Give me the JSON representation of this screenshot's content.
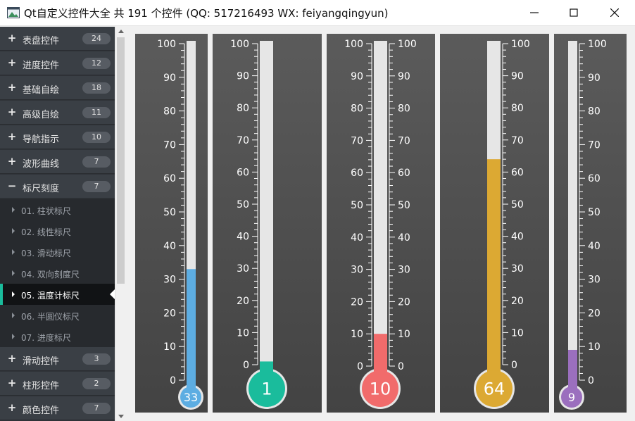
{
  "window": {
    "title": "Qt自定义控件大全 共 191 个控件 (QQ: 517216493 WX: feiyangqingyun)",
    "controls": [
      "minimize-icon",
      "maximize-icon",
      "close-icon"
    ]
  },
  "sidebar": {
    "groups": [
      {
        "sign": "+",
        "label": "表盘控件",
        "count": "24"
      },
      {
        "sign": "+",
        "label": "进度控件",
        "count": "12"
      },
      {
        "sign": "+",
        "label": "基础自绘",
        "count": "18"
      },
      {
        "sign": "+",
        "label": "高级自绘",
        "count": "11"
      },
      {
        "sign": "+",
        "label": "导航指示",
        "count": "10"
      },
      {
        "sign": "+",
        "label": "波形曲线",
        "count": "7"
      },
      {
        "sign": "−",
        "label": "标尺刻度",
        "count": "7"
      },
      {
        "sign": "+",
        "label": "滑动控件",
        "count": "3"
      },
      {
        "sign": "+",
        "label": "柱形控件",
        "count": "2"
      },
      {
        "sign": "+",
        "label": "颜色控件",
        "count": "7"
      }
    ],
    "children": [
      {
        "label": "01. 柱状标尺"
      },
      {
        "label": "02. 线性标尺"
      },
      {
        "label": "03. 滑动标尺"
      },
      {
        "label": "04. 双向刻度尺"
      },
      {
        "label": "05. 温度计标尺"
      },
      {
        "label": "06. 半圆仪标尺"
      },
      {
        "label": "07. 进度标尺"
      }
    ],
    "selected_child": "05. 温度计标尺"
  },
  "thermometers": [
    {
      "value": 33,
      "value_label": "33",
      "min": 0,
      "max": 100,
      "color": "#5dade2",
      "scale": "left",
      "tick_labels": [
        "100",
        "90",
        "80",
        "70",
        "60",
        "50",
        "40",
        "30",
        "20",
        "10",
        "0"
      ]
    },
    {
      "value": 1,
      "value_label": "1",
      "min": 0,
      "max": 100,
      "color": "#1abc9c",
      "scale": "left",
      "tick_labels": [
        "100",
        "90",
        "80",
        "70",
        "60",
        "50",
        "40",
        "30",
        "20",
        "10",
        "0"
      ]
    },
    {
      "value": 10,
      "value_label": "10",
      "min": 0,
      "max": 100,
      "color": "#f16b6b",
      "scale": "both",
      "tick_labels": [
        "100",
        "90",
        "80",
        "70",
        "60",
        "50",
        "40",
        "30",
        "20",
        "10",
        "0"
      ]
    },
    {
      "value": 64,
      "value_label": "64",
      "min": 0,
      "max": 100,
      "color": "#dca933",
      "scale": "right",
      "tick_labels": [
        "100",
        "90",
        "80",
        "70",
        "60",
        "50",
        "40",
        "30",
        "20",
        "10",
        "0"
      ]
    },
    {
      "value": 9,
      "value_label": "9",
      "min": 0,
      "max": 100,
      "color": "#9b6fbe",
      "scale": "right",
      "tick_labels": [
        "100",
        "90",
        "80",
        "70",
        "60",
        "50",
        "40",
        "30",
        "20",
        "10",
        "0"
      ]
    }
  ]
}
